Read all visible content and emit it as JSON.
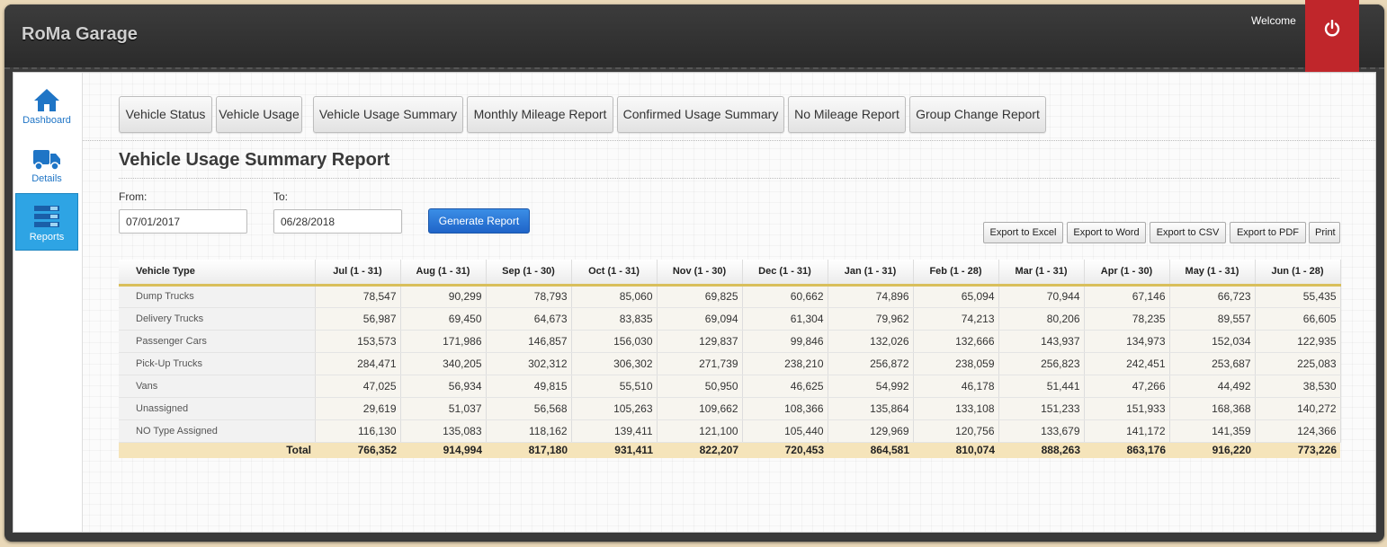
{
  "app": {
    "title": "RoMa Garage",
    "welcome": "Welcome"
  },
  "sidebar": {
    "items": [
      {
        "label": "Dashboard",
        "icon": "home-icon"
      },
      {
        "label": "Details",
        "icon": "truck-icon"
      },
      {
        "label": "Reports",
        "icon": "list-icon"
      }
    ]
  },
  "tabs": [
    "Vehicle Status",
    "Vehicle Usage",
    "Vehicle Usage Summary",
    "Monthly Mileage Report",
    "Confirmed Usage Summary",
    "No Mileage Report",
    "Group Change Report"
  ],
  "page": {
    "title": "Vehicle Usage Summary Report"
  },
  "form": {
    "from_label": "From:",
    "from_value": "07/01/2017",
    "to_label": "To:",
    "to_value": "06/28/2018",
    "generate_label": "Generate Report"
  },
  "export": [
    "Export to Excel",
    "Export to Word",
    "Export to CSV",
    "Export to PDF",
    "Print"
  ],
  "table": {
    "headers": [
      "Vehicle Type",
      "Jul (1 - 31)",
      "Aug (1 - 31)",
      "Sep (1 - 30)",
      "Oct (1 - 31)",
      "Nov (1 - 30)",
      "Dec (1 - 31)",
      "Jan (1 - 31)",
      "Feb (1 - 28)",
      "Mar (1 - 31)",
      "Apr (1 - 30)",
      "May (1 - 31)",
      "Jun (1 - 28)"
    ],
    "rows": [
      [
        "Dump Trucks",
        "78,547",
        "90,299",
        "78,793",
        "85,060",
        "69,825",
        "60,662",
        "74,896",
        "65,094",
        "70,944",
        "67,146",
        "66,723",
        "55,435"
      ],
      [
        "Delivery Trucks",
        "56,987",
        "69,450",
        "64,673",
        "83,835",
        "69,094",
        "61,304",
        "79,962",
        "74,213",
        "80,206",
        "78,235",
        "89,557",
        "66,605"
      ],
      [
        "Passenger Cars",
        "153,573",
        "171,986",
        "146,857",
        "156,030",
        "129,837",
        "99,846",
        "132,026",
        "132,666",
        "143,937",
        "134,973",
        "152,034",
        "122,935"
      ],
      [
        "Pick-Up Trucks",
        "284,471",
        "340,205",
        "302,312",
        "306,302",
        "271,739",
        "238,210",
        "256,872",
        "238,059",
        "256,823",
        "242,451",
        "253,687",
        "225,083"
      ],
      [
        "Vans",
        "47,025",
        "56,934",
        "49,815",
        "55,510",
        "50,950",
        "46,625",
        "54,992",
        "46,178",
        "51,441",
        "47,266",
        "44,492",
        "38,530"
      ],
      [
        "Unassigned",
        "29,619",
        "51,037",
        "56,568",
        "105,263",
        "109,662",
        "108,366",
        "135,864",
        "133,108",
        "151,233",
        "151,933",
        "168,368",
        "140,272"
      ],
      [
        "NO Type Assigned",
        "116,130",
        "135,083",
        "118,162",
        "139,411",
        "121,100",
        "105,440",
        "129,969",
        "120,756",
        "133,679",
        "141,172",
        "141,359",
        "124,366"
      ]
    ],
    "total": [
      "Total",
      "766,352",
      "914,994",
      "817,180",
      "931,411",
      "822,207",
      "720,453",
      "864,581",
      "810,074",
      "888,263",
      "863,176",
      "916,220",
      "773,226"
    ]
  },
  "colors": {
    "accent": "#2ea4e4",
    "logout": "#c0262b",
    "total_row": "#f5e4ba",
    "header_rule": "#d9bf5b"
  }
}
